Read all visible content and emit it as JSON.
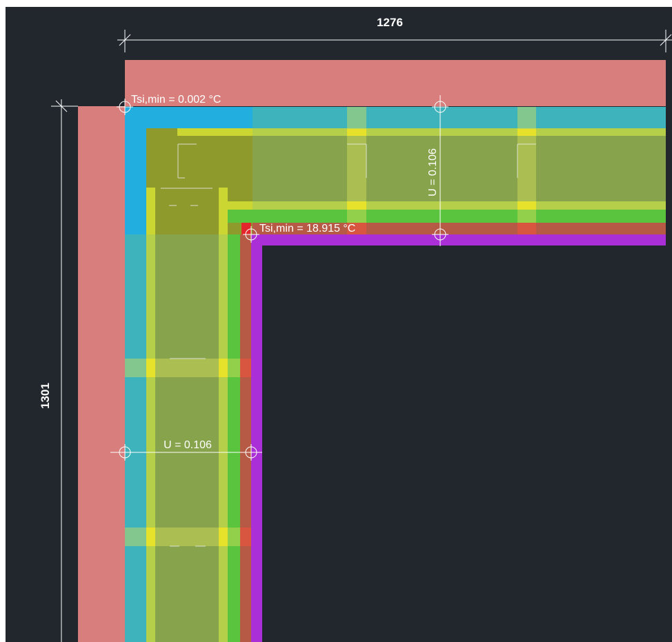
{
  "dimensions": {
    "top": "1276",
    "left": "1301"
  },
  "annotations": {
    "tsi_outer": "Tsi,min = 0.002 °C",
    "tsi_inner": "Tsi,min = 18.915 °C",
    "u_top": "U = 0.106",
    "u_left": "U = 0.106"
  },
  "colors": {
    "background": "#22272e",
    "cladding": "#d87f7d",
    "cyan_layer": "#3eb3bb",
    "blue_layer": "#23aee0",
    "insulation": "#87a34b",
    "yellow_band": "#cbd633",
    "green_layer": "#5ac43f",
    "brown_layer": "#b65a46",
    "purple_layer": "#aa2fd6",
    "line": "#ffffff"
  }
}
